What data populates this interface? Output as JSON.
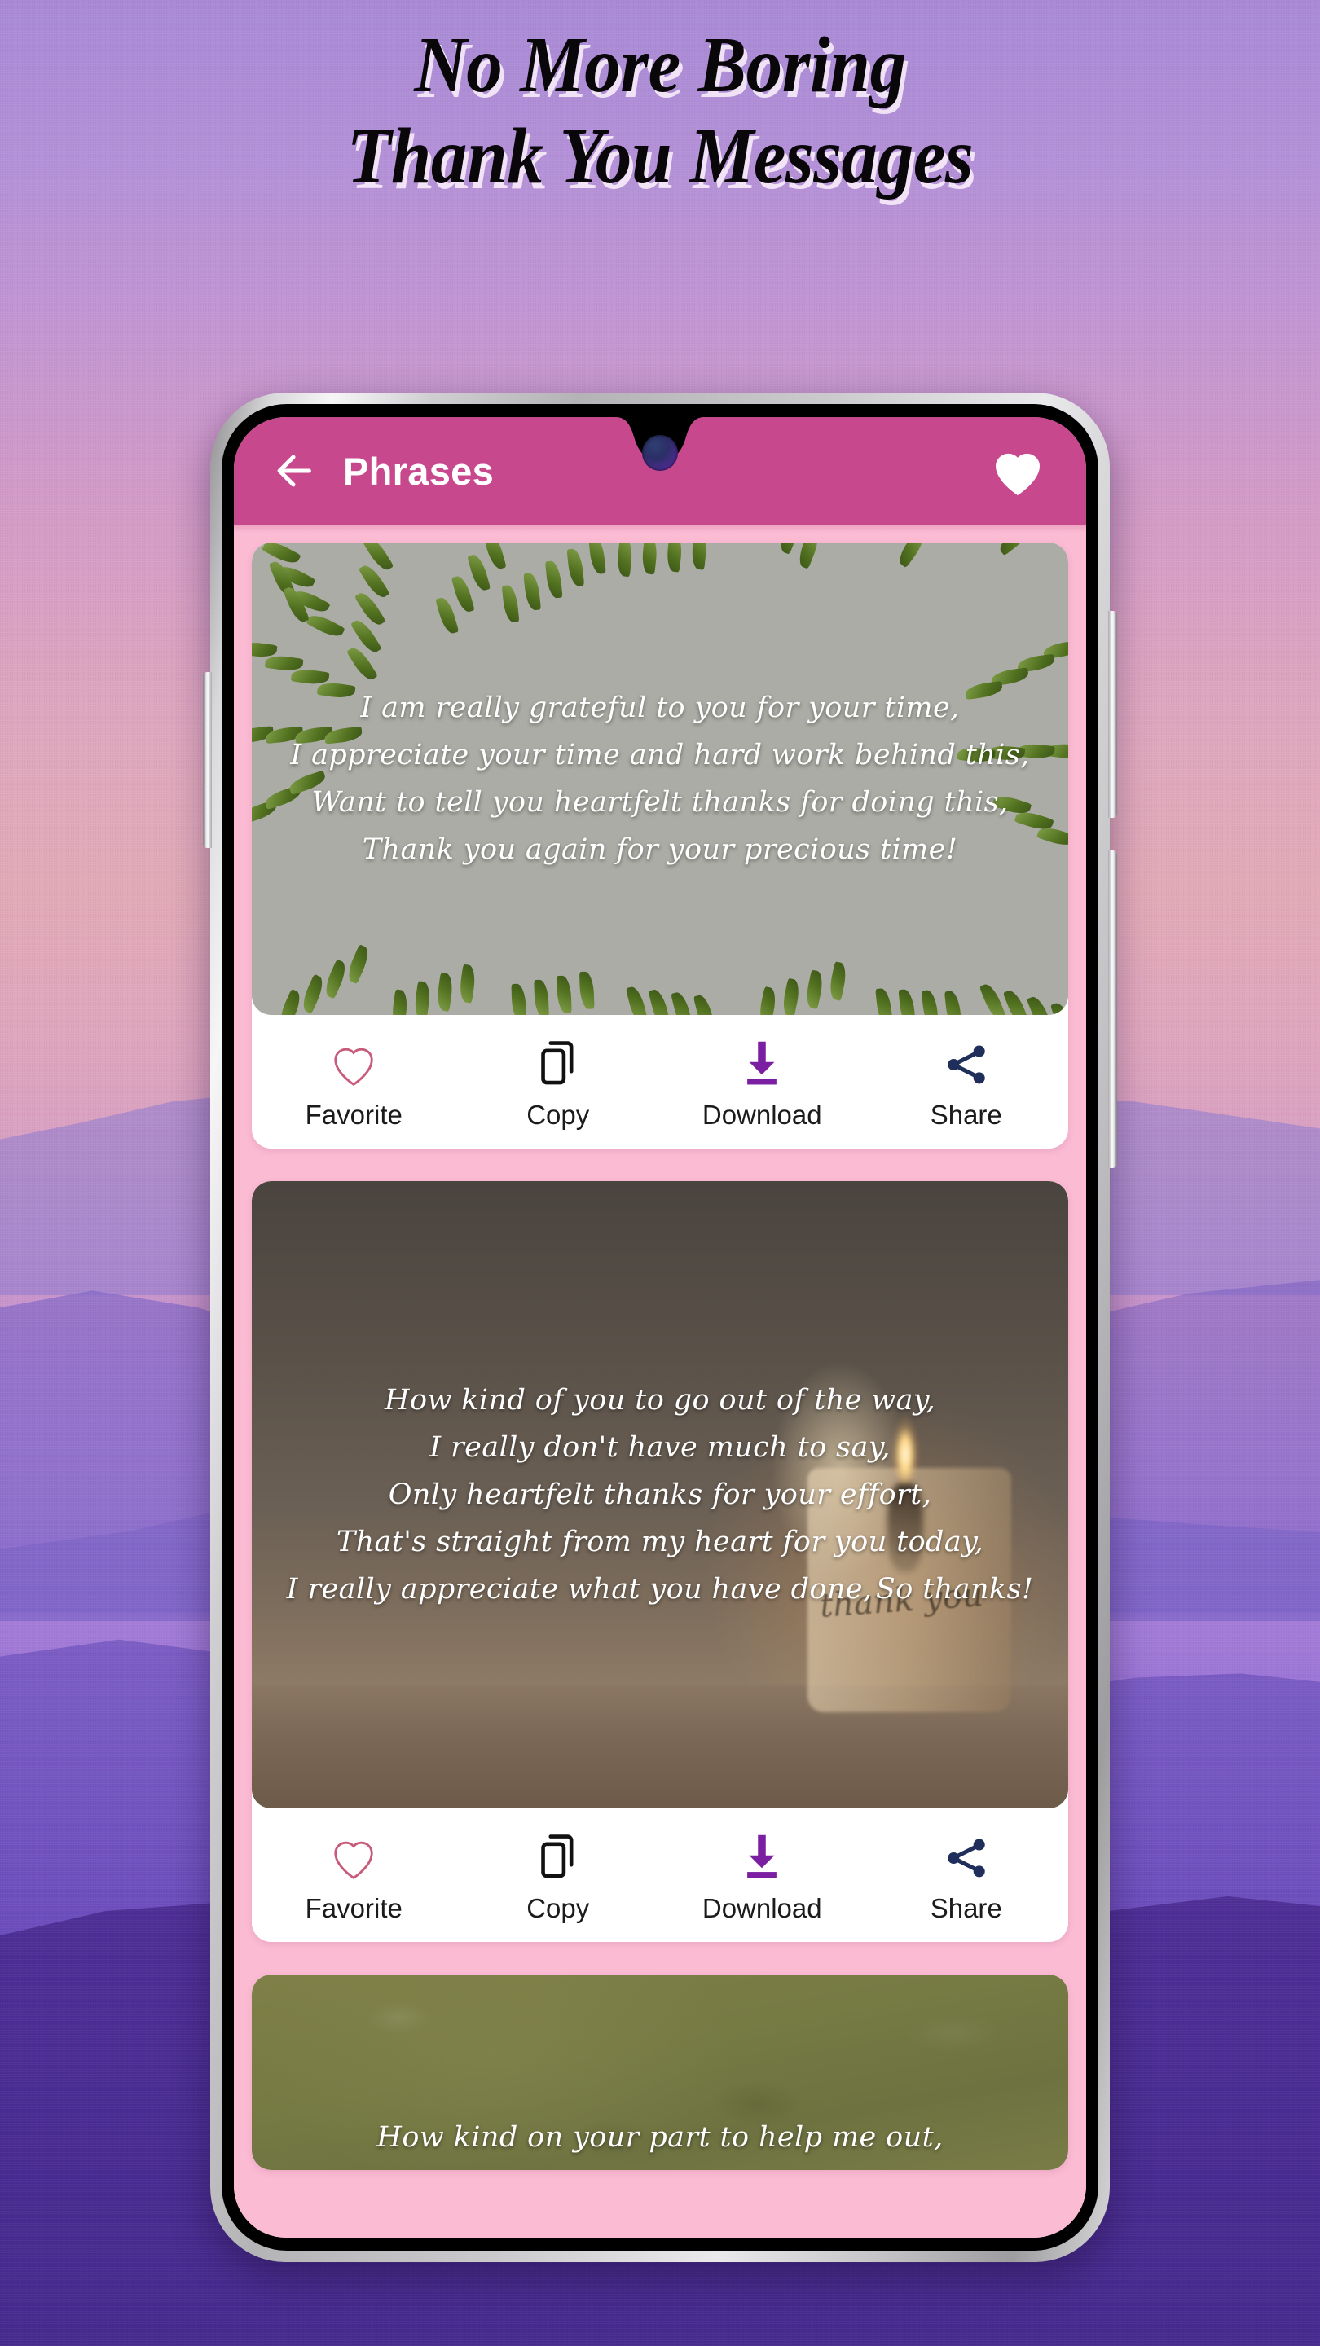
{
  "promo": {
    "headline_line1": "No More Boring",
    "headline_line2": "Thank You Messages"
  },
  "colors": {
    "appbar_pink": "#C8488E",
    "app_background_pink": "#FBBBD3",
    "download_purple": "#7B1FA2",
    "share_navy": "#1F2E5A",
    "favorite_outline": "#C85A7A",
    "card_white": "#FFFFFF"
  },
  "appbar": {
    "back_label": "Back",
    "title": "Phrases",
    "favorite_label": "Favorites"
  },
  "actions": {
    "favorite": "Favorite",
    "copy": "Copy",
    "download": "Download",
    "share": "Share"
  },
  "cards": [
    {
      "id": "card-1",
      "background": "grey-botanical-leaves",
      "lines": [
        "I am really grateful to you for your time,",
        "I appreciate your time and hard work behind this,",
        "Want to tell you heartfelt thanks for doing this,",
        "Thank you again for your precious time!"
      ]
    },
    {
      "id": "card-2",
      "background": "candle-photo",
      "candle_label": "thank you",
      "lines": [
        "How kind of you to go out of the way,",
        "I really don't have much to say,",
        "Only heartfelt thanks for your effort,",
        "That's straight from my heart for you today,",
        "I really appreciate what you have done,",
        "So thanks!"
      ]
    },
    {
      "id": "card-3",
      "background": "olive-green",
      "lines": [
        "How kind on your part to help me out,"
      ]
    }
  ]
}
